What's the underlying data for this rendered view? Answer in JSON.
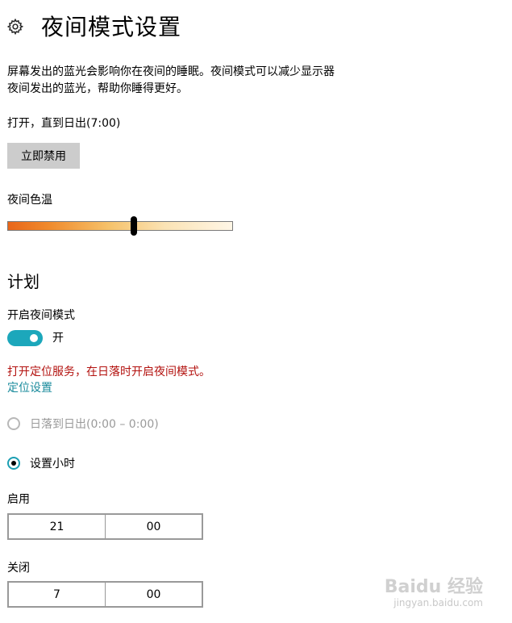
{
  "header": {
    "icon": "gear-icon",
    "title": "夜间模式设置"
  },
  "description": [
    "屏幕发出的蓝光会影响你在夜间的睡眠。夜间模式可以减少显示器",
    "夜间发出的蓝光，帮助你睡得更好。"
  ],
  "status_text": "打开，直到日出(7:00)",
  "disable_button_label": "立即禁用",
  "color_temperature": {
    "label": "夜间色温",
    "level": 0.56
  },
  "schedule": {
    "title": "计划",
    "night_mode_label": "开启夜间模式",
    "toggle": {
      "state": "on",
      "label": "开"
    },
    "location_warning": "打开定位服务，在日落时开启夜间模式。",
    "location_link": "定位设置",
    "options": [
      {
        "label": "日落到日出(0:00 – 0:00)",
        "selected": false,
        "disabled": true
      },
      {
        "label": "设置小时",
        "selected": true,
        "disabled": false
      }
    ],
    "start": {
      "label": "启用",
      "hour": "21",
      "minute": "00"
    },
    "end": {
      "label": "关闭",
      "hour": "7",
      "minute": "00"
    }
  },
  "colors": {
    "accent": "#1ca7bb",
    "warning": "#b3120f",
    "link": "#1a8b9c"
  },
  "watermark": {
    "brand": "Baidu 经验",
    "url": "jingyan.baidu.com"
  }
}
